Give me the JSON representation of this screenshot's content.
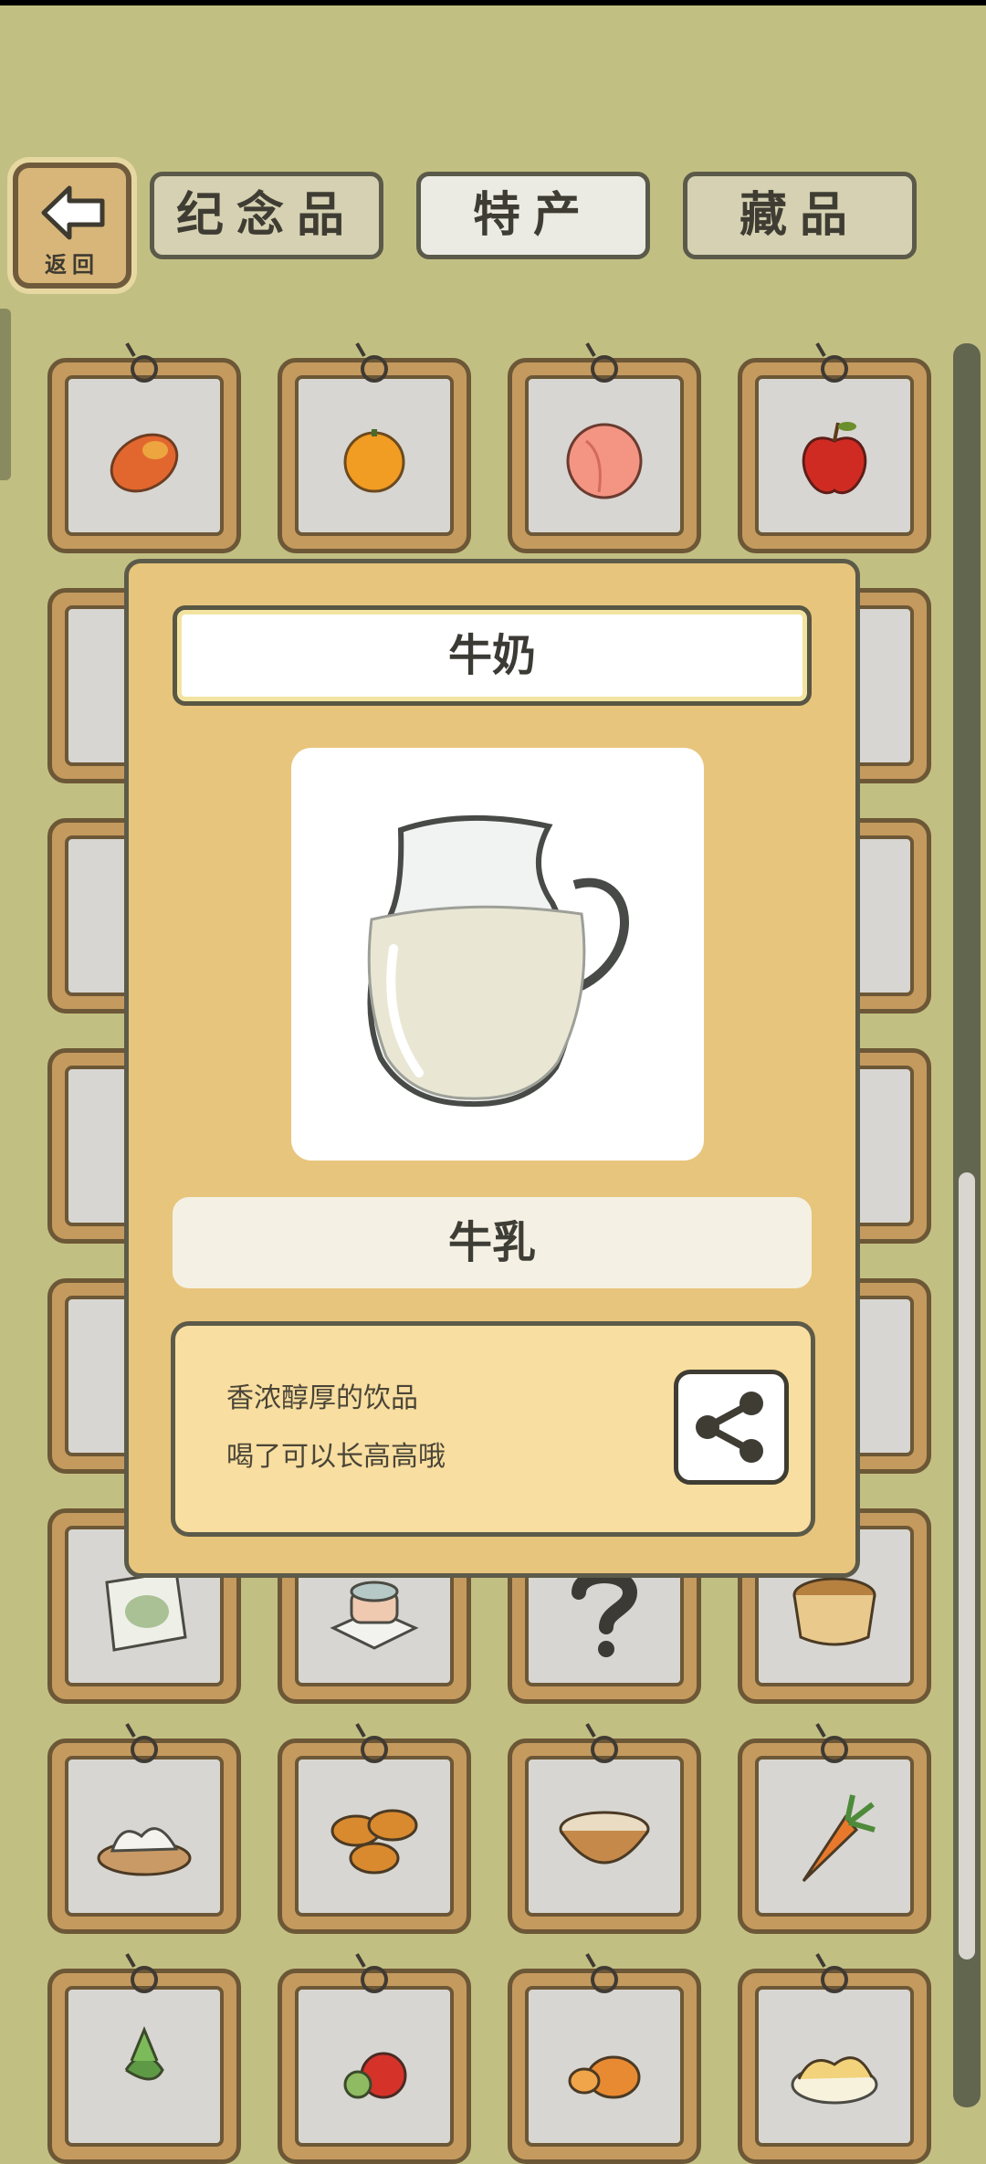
{
  "nav": {
    "back_label": "返回",
    "tabs": [
      {
        "label": "纪念品",
        "active": false
      },
      {
        "label": "特产",
        "active": true
      },
      {
        "label": "藏品",
        "active": false
      }
    ]
  },
  "modal": {
    "title": "牛奶",
    "item_name": "牛乳",
    "description": [
      "香浓醇厚的饮品",
      "喝了可以长高高哦"
    ],
    "image_icon": "milk-jug-icon",
    "share_icon": "share-icon"
  },
  "grid_icons": {
    "row1": [
      "mango-icon",
      "orange-icon",
      "peach-icon",
      "apple-icon"
    ],
    "row6": [
      "snack-bag-icon",
      "cake-icon",
      "unknown-item-icon",
      "basket-icon"
    ],
    "row7": [
      "dumplings-icon",
      "egg-tarts-icon",
      "rice-bowl-icon",
      "carrot-icon"
    ],
    "row8": [
      "radish-icon",
      "tomato-icon",
      "pumpkin-icon",
      "pastry-icon"
    ]
  },
  "colors": {
    "background": "#c2bf83",
    "modal": "#e8c57c",
    "card_frame": "#c49a5e",
    "desc_box": "#f8dea0"
  }
}
